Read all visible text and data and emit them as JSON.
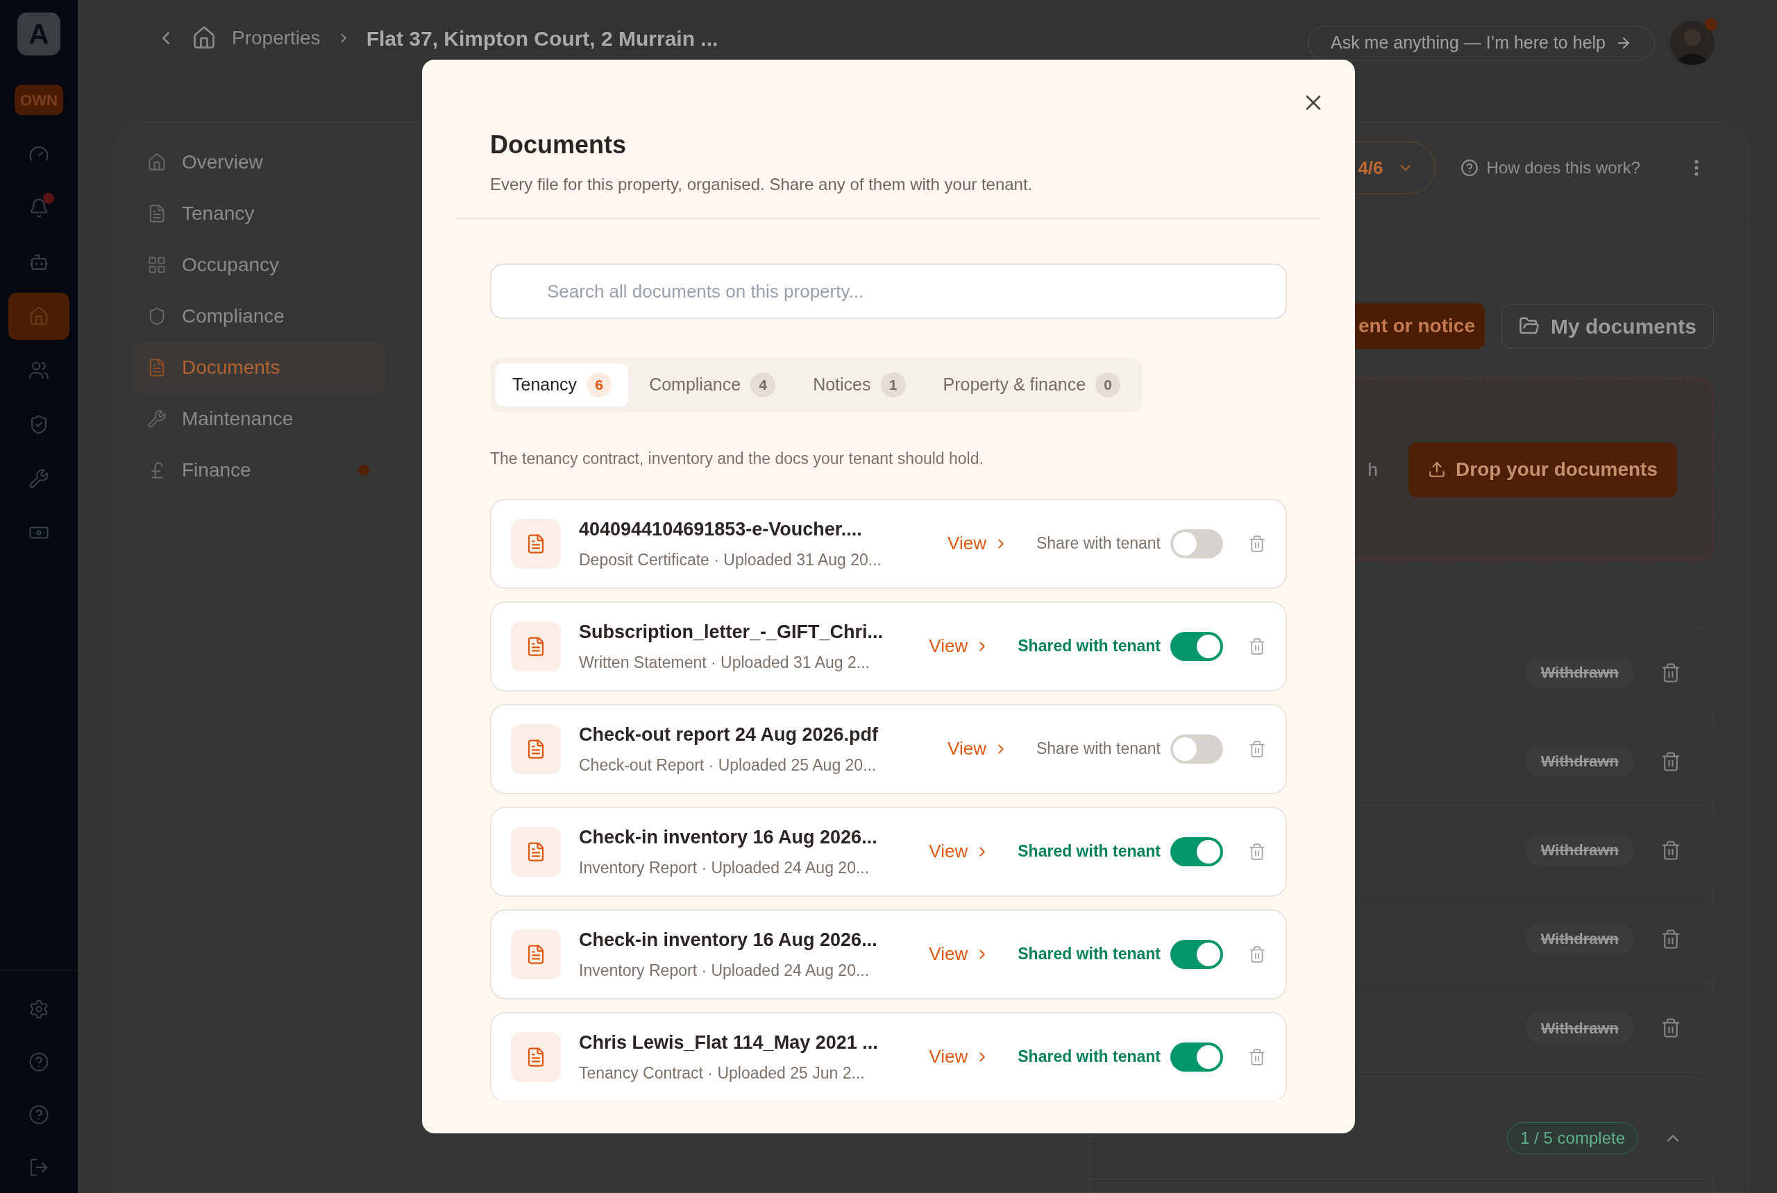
{
  "rail": {
    "logo": "A",
    "badge": "OWN",
    "items": [
      {
        "selected": false,
        "alert": false
      },
      {
        "selected": false,
        "alert": true
      },
      {
        "selected": false,
        "alert": false
      },
      {
        "selected": true,
        "alert": false
      },
      {
        "selected": false,
        "alert": false
      },
      {
        "selected": false,
        "alert": false
      },
      {
        "selected": false,
        "alert": false
      },
      {
        "selected": false,
        "alert": false
      }
    ]
  },
  "breadcrumb": [
    "Properties",
    "Flat 37, Kimpton Court, 2 Murrain ..."
  ],
  "assistant": {
    "label": "Ask me anything — I’m here to help"
  },
  "avatar": {
    "alert": true
  },
  "nav": [
    {
      "label": "Overview",
      "selected": false,
      "alert": false
    },
    {
      "label": "Tenancy",
      "selected": false,
      "alert": false
    },
    {
      "label": "Occupancy",
      "selected": false,
      "alert": false
    },
    {
      "label": "Compliance",
      "selected": false,
      "alert": false
    },
    {
      "label": "Documents",
      "selected": true,
      "alert": false
    },
    {
      "label": "Maintenance",
      "selected": false,
      "alert": false
    },
    {
      "label": "Finance",
      "selected": false,
      "alert": true
    }
  ],
  "header": {
    "progress": "4/6",
    "help": "How does this work?"
  },
  "actions": {
    "primary": "ent or notice",
    "secondary": "My documents"
  },
  "dropzone": {
    "text": "h",
    "button": "Drop your documents"
  },
  "withdrawn": [
    "Withdrawn",
    "Withdrawn",
    "Withdrawn",
    "Withdrawn",
    "Withdrawn"
  ],
  "checklist": {
    "status": "1 / 5 complete"
  },
  "modal": {
    "title": "Documents",
    "subtitle": "Every file for this property, organised. Share any of them with your tenant.",
    "search": {
      "placeholder": "Search all documents on this property..."
    },
    "tabs": [
      {
        "label": "Tenancy",
        "count": "6",
        "selected": true
      },
      {
        "label": "Compliance",
        "count": "4",
        "selected": false
      },
      {
        "label": "Notices",
        "count": "1",
        "selected": false
      },
      {
        "label": "Property & finance",
        "count": "0",
        "selected": false
      }
    ],
    "description": "The tenancy contract, inventory and the docs your tenant should hold.",
    "documents": [
      {
        "name": "4040944104691853-e-Voucher....",
        "meta": "Deposit Certificate · Uploaded 31 Aug 20...",
        "view": "View",
        "share_label": "Share with tenant",
        "shared": false
      },
      {
        "name": "Subscription_letter_-_GIFT_Chri...",
        "meta": "Written Statement · Uploaded 31 Aug 2...",
        "view": "View",
        "share_label": "Shared with tenant",
        "shared": true
      },
      {
        "name": "Check-out report 24 Aug 2026.pdf",
        "meta": "Check-out Report · Uploaded 25 Aug 20...",
        "view": "View",
        "share_label": "Share with tenant",
        "shared": false
      },
      {
        "name": "Check-in inventory 16 Aug 2026...",
        "meta": "Inventory Report · Uploaded 24 Aug 20...",
        "view": "View",
        "share_label": "Shared with tenant",
        "shared": true
      },
      {
        "name": "Check-in inventory 16 Aug 2026...",
        "meta": "Inventory Report · Uploaded 24 Aug 20...",
        "view": "View",
        "share_label": "Shared with tenant",
        "shared": true
      },
      {
        "name": "Chris Lewis_Flat 114_May 2021 ...",
        "meta": "Tenancy Contract · Uploaded 25 Jun 2...",
        "view": "View",
        "share_label": "Shared with tenant",
        "shared": true
      }
    ]
  }
}
